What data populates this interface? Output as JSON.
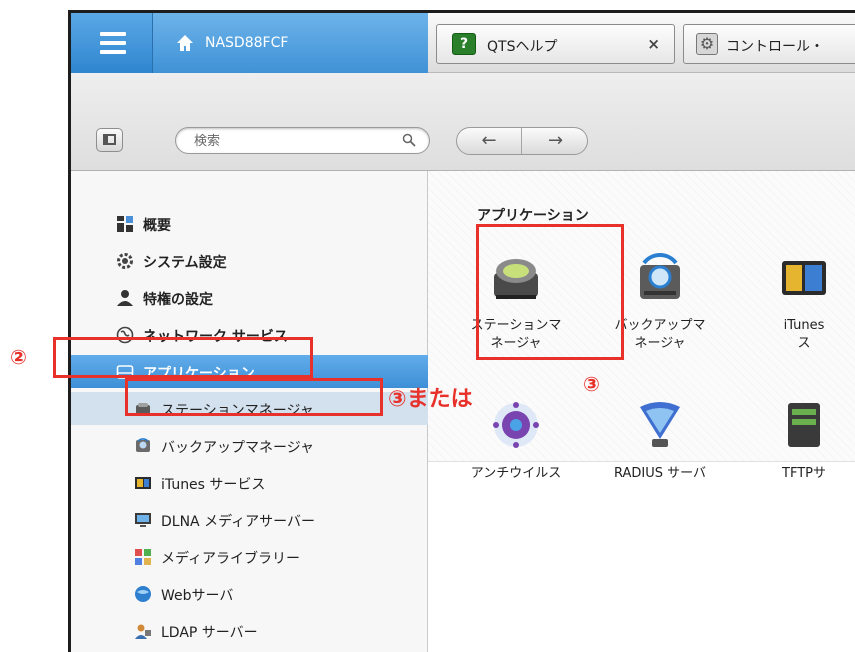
{
  "header": {
    "nas_name": "NASD88FCF",
    "tabs": [
      {
        "label": "QTSヘルプ",
        "close": "×",
        "icon": "help-book-icon"
      },
      {
        "label": "コントロール・",
        "icon": "gear-icon"
      }
    ]
  },
  "toolbar": {
    "search_placeholder": "検索",
    "back": "←",
    "forward": "→"
  },
  "sidebar": {
    "items": [
      {
        "label": "概要",
        "icon": "overview-grid-icon"
      },
      {
        "label": "システム設定",
        "icon": "gear-icon"
      },
      {
        "label": "特権の設定",
        "icon": "user-icon"
      },
      {
        "label": "ネットワーク サービス",
        "icon": "globe-icon"
      },
      {
        "label": "アプリケーション",
        "icon": "application-icon",
        "active": true
      }
    ],
    "subitems": [
      {
        "label": "ステーションマネージャ",
        "icon": "station-manager-icon",
        "selected": true
      },
      {
        "label": "バックアップマネージャ",
        "icon": "backup-manager-icon"
      },
      {
        "label": "iTunes サービス",
        "icon": "itunes-icon"
      },
      {
        "label": "DLNA メディアサーバー",
        "icon": "dlna-icon"
      },
      {
        "label": "メディアライブラリー",
        "icon": "media-library-icon"
      },
      {
        "label": "Webサーバ",
        "icon": "web-server-icon"
      },
      {
        "label": "LDAP サーバー",
        "icon": "ldap-icon"
      }
    ]
  },
  "content": {
    "section_title": "アプリケーション",
    "apps": [
      {
        "label": "ステーションマ\nネージャ",
        "icon": "station-manager-icon"
      },
      {
        "label": "バックアップマ\nネージャ",
        "icon": "backup-manager-icon"
      },
      {
        "label": "iTunes\nス",
        "icon": "itunes-icon"
      },
      {
        "label": "アンチウイルス",
        "icon": "antivirus-icon"
      },
      {
        "label": "RADIUS サーバ",
        "icon": "radius-icon"
      },
      {
        "label": "TFTPサ",
        "icon": "tftp-icon"
      }
    ]
  },
  "annotations": {
    "step2": "②",
    "step3_or": "③または",
    "step3": "③",
    "color": "#e8312b"
  }
}
